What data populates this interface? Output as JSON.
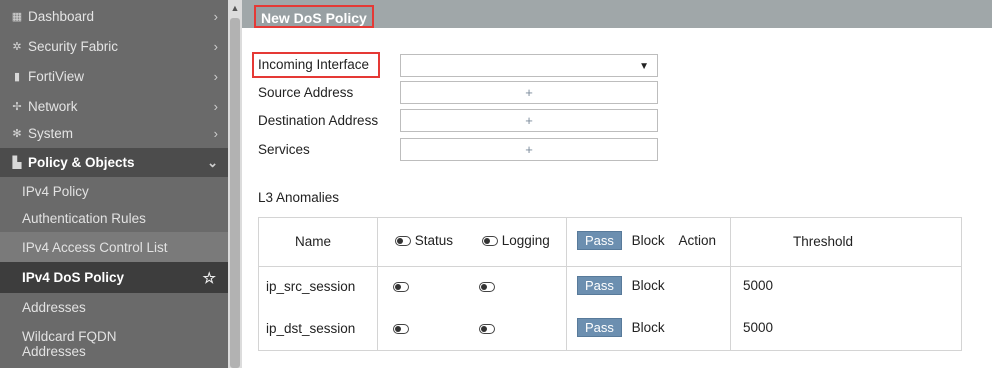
{
  "sidebar": {
    "items": [
      {
        "label": "Dashboard",
        "icon": "dashboard-icon"
      },
      {
        "label": "Security Fabric",
        "icon": "security-fabric-icon"
      },
      {
        "label": "FortiView",
        "icon": "fortiview-icon"
      },
      {
        "label": "Network",
        "icon": "network-icon"
      },
      {
        "label": "System",
        "icon": "gear-icon"
      }
    ],
    "section": {
      "label": "Policy & Objects",
      "icon": "policy-icon"
    },
    "sub_items": [
      "IPv4 Policy",
      "Authentication Rules",
      "IPv4 Access Control List",
      "IPv4 DoS Policy",
      "Addresses",
      "Wildcard FQDN",
      "Addresses"
    ]
  },
  "page": {
    "title": "New DoS Policy"
  },
  "form": {
    "incoming_interface": {
      "label": "Incoming Interface",
      "value": ""
    },
    "source_address": {
      "label": "Source Address",
      "add": "+"
    },
    "destination_address": {
      "label": "Destination Address",
      "add": "+"
    },
    "services": {
      "label": "Services",
      "add": "+"
    }
  },
  "l3": {
    "title": "L3 Anomalies",
    "headers": {
      "name": "Name",
      "status": "Status",
      "logging": "Logging",
      "pass": "Pass",
      "block": "Block",
      "action": "Action",
      "threshold": "Threshold"
    },
    "rows": [
      {
        "name": "ip_src_session",
        "pass": "Pass",
        "block": "Block",
        "threshold": "5000"
      },
      {
        "name": "ip_dst_session",
        "pass": "Pass",
        "block": "Block",
        "threshold": "5000"
      }
    ]
  }
}
